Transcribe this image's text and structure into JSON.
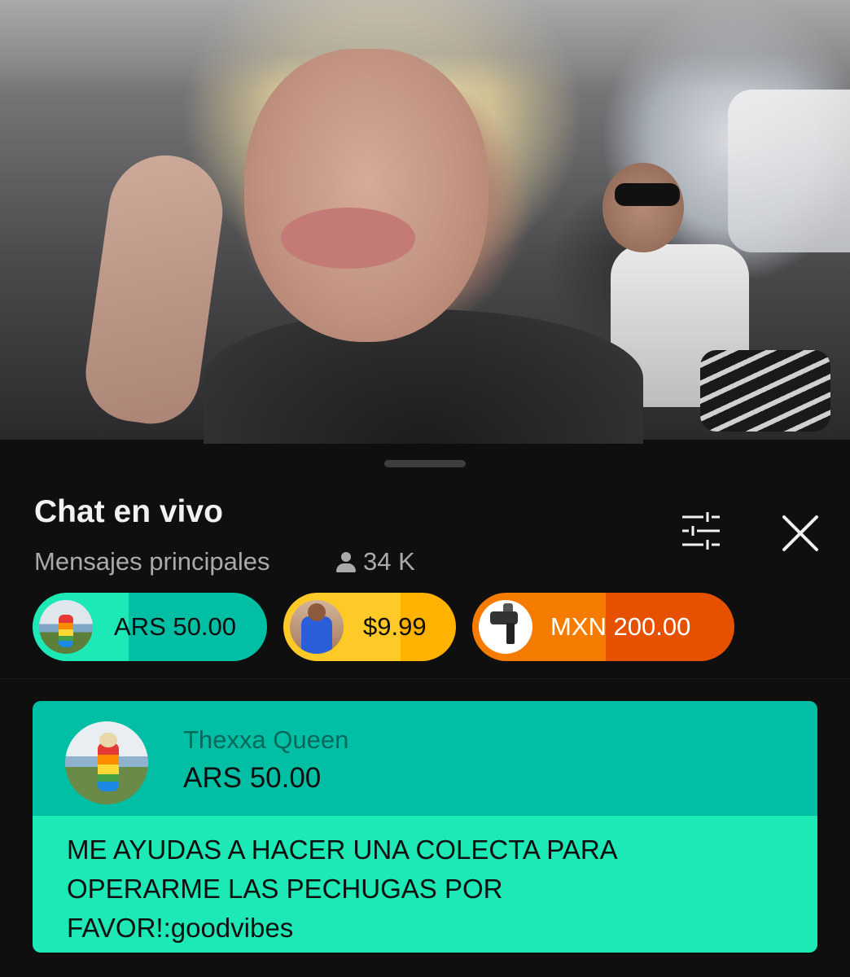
{
  "video": {
    "description_icon": "live-video-frame"
  },
  "chat": {
    "title": "Chat en vivo",
    "mode": "Mensajes principales",
    "viewers": "34 K",
    "viewers_icon": "person-icon",
    "filter_icon": "filter-sliders-icon",
    "close_icon": "close-icon"
  },
  "ticker": [
    {
      "amount": "ARS 50.00",
      "color_primary": "#1de9b6",
      "color_secondary": "#00bfa5",
      "progress": 0.41
    },
    {
      "amount": "$9.99",
      "color_primary": "#ffca28",
      "color_secondary": "#ffb300",
      "progress": 0.68
    },
    {
      "amount": "MXN 200.00",
      "color_primary": "#f57c00",
      "color_secondary": "#e65100",
      "progress": 0.51
    }
  ],
  "superchat": {
    "author": "Thexxa Queen",
    "amount": "ARS 50.00",
    "message": "ME AYUDAS A HACER UNA COLECTA PARA OPERARME LAS PECHUGAS POR FAVOR!:goodvibes",
    "header_color": "#00bfa5",
    "body_color": "#1de9b6"
  }
}
